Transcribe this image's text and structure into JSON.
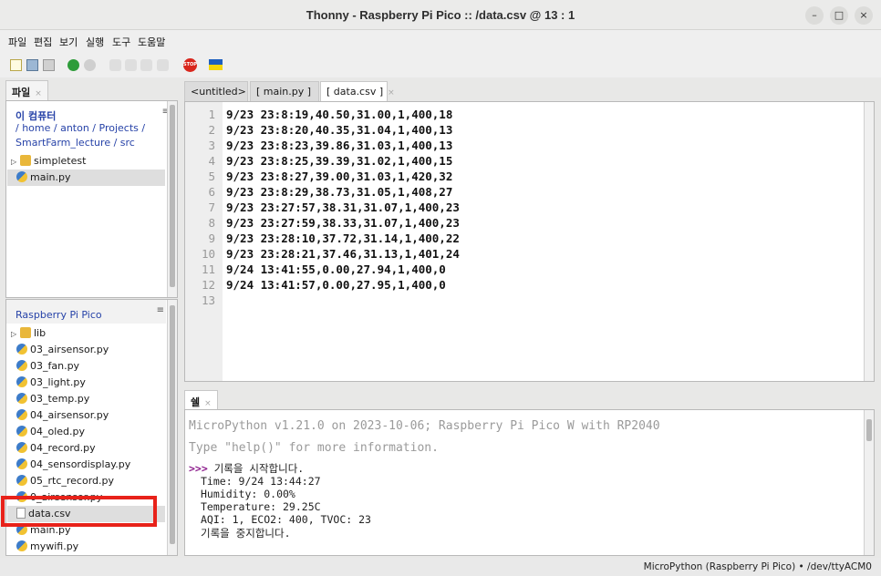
{
  "window": {
    "title": "Thonny  -  Raspberry Pi Pico :: /data.csv  @  13 : 1",
    "min_symbol": "–",
    "max_symbol": "□",
    "close_symbol": "×"
  },
  "menu": [
    "파일",
    "편집",
    "보기",
    "실행",
    "도구",
    "도움말"
  ],
  "toolbar": {
    "icons": [
      "new-file-icon",
      "open-file-icon",
      "save-file-icon",
      "run-icon",
      "debug-icon",
      "step-over-icon",
      "step-into-icon",
      "step-out-icon",
      "resume-icon",
      "stop-icon",
      "ukraine-flag-icon"
    ],
    "stop_label": "STOP"
  },
  "files_panel": {
    "tab_label": "파일",
    "this_computer": {
      "title": "이 컴퓨터",
      "path_line1": "/ home / anton / Projects /",
      "path_line2": "SmartFarm_lecture / src",
      "items": [
        {
          "name": "simpletest",
          "type": "folder"
        },
        {
          "name": "main.py",
          "type": "py"
        }
      ]
    },
    "pico": {
      "title": "Raspberry Pi Pico",
      "items": [
        {
          "name": "lib",
          "type": "folder"
        },
        {
          "name": "03_airsensor.py",
          "type": "py"
        },
        {
          "name": "03_fan.py",
          "type": "py"
        },
        {
          "name": "03_light.py",
          "type": "py"
        },
        {
          "name": "03_temp.py",
          "type": "py"
        },
        {
          "name": "04_airsensor.py",
          "type": "py"
        },
        {
          "name": "04_oled.py",
          "type": "py"
        },
        {
          "name": "04_record.py",
          "type": "py"
        },
        {
          "name": "04_sensordisplay.py",
          "type": "py"
        },
        {
          "name": "05_rtc_record.py",
          "type": "py"
        },
        {
          "name": "0_airsensor.py",
          "type": "py"
        },
        {
          "name": "data.csv",
          "type": "file"
        },
        {
          "name": "main.py",
          "type": "py"
        },
        {
          "name": "mywifi.py",
          "type": "py"
        }
      ]
    },
    "menu_symbol": "≡"
  },
  "editor": {
    "tabs": [
      "<untitled>",
      "[ main.py ]",
      "[ data.csv ]"
    ],
    "close_symbol": "×",
    "lines": [
      "9/23 23:8:19,40.50,31.00,1,400,18",
      "9/23 23:8:20,40.35,31.04,1,400,13",
      "9/23 23:8:23,39.86,31.03,1,400,13",
      "9/23 23:8:25,39.39,31.02,1,400,15",
      "9/23 23:8:27,39.00,31.03,1,420,32",
      "9/23 23:8:29,38.73,31.05,1,408,27",
      "9/23 23:27:57,38.31,31.07,1,400,23",
      "9/23 23:27:59,38.33,31.07,1,400,23",
      "9/23 23:28:10,37.72,31.14,1,400,22",
      "9/23 23:28:21,37.46,31.13,1,401,24",
      "9/24 13:41:55,0.00,27.94,1,400,0",
      "9/24 13:41:57,0.00,27.95,1,400,0",
      ""
    ]
  },
  "shell": {
    "tab_label": "쉘",
    "banner1": "MicroPython v1.21.0 on 2023-10-06; Raspberry Pi Pico W with RP2040",
    "banner2": "Type \"help()\" for more information.",
    "prompt": ">>>",
    "command": "기록을 시작합니다.",
    "output": [
      "Time: 9/24 13:44:27",
      "Humidity: 0.00%",
      "Temperature: 29.25C",
      "AQI: 1, ECO2: 400, TVOC: 23",
      "기록을 중지합니다."
    ]
  },
  "status": {
    "text": "MicroPython (Raspberry Pi Pico)  •  /dev/ttyACM0"
  },
  "colors": {
    "highlight_box": "#e8221a",
    "path_link": "#2743a8",
    "prompt": "#8b1a8b"
  }
}
